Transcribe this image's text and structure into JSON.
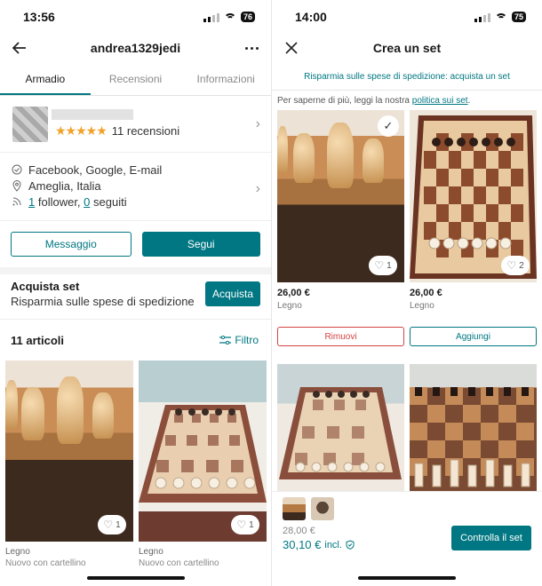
{
  "left": {
    "status": {
      "time": "13:56",
      "battery": "76"
    },
    "header": {
      "title": "andrea1329jedi"
    },
    "tabs": [
      {
        "label": "Armadio",
        "active": true
      },
      {
        "label": "Recensioni",
        "active": false
      },
      {
        "label": "Informazioni",
        "active": false
      }
    ],
    "profile": {
      "stars": "★★★★★",
      "reviews": "11 recensioni"
    },
    "details": {
      "verified": "Facebook, Google, E-mail",
      "location": "Ameglia, Italia",
      "followers_num": "1",
      "followers_label": " follower, ",
      "following_num": "0",
      "following_label": " seguiti"
    },
    "buttons": {
      "message": "Messaggio",
      "follow": "Segui"
    },
    "bundle": {
      "title": "Acquista set",
      "subtitle": "Risparmia sulle spese di spedizione",
      "button": "Acquista"
    },
    "articles": {
      "count": "11 articoli",
      "filter": "Filtro"
    },
    "items": [
      {
        "likes": "1",
        "brand": "Legno",
        "condition": "Nuovo con cartellino"
      },
      {
        "likes": "1",
        "brand": "Legno",
        "condition": "Nuovo con cartellino"
      }
    ]
  },
  "right": {
    "status": {
      "time": "14:00",
      "battery": "75"
    },
    "header": {
      "title": "Crea un set"
    },
    "promo": "Risparmia sulle spese di spedizione: acquista un set",
    "info": {
      "text": "Per saperne di più, leggi la nostra ",
      "link": "politica sui set",
      "end": "."
    },
    "items": [
      {
        "likes": "1",
        "price": "26,00 €",
        "brand": "Legno",
        "action": "Rimuovi",
        "selected": true
      },
      {
        "likes": "2",
        "price": "26,00 €",
        "brand": "Legno",
        "action": "Aggiungi",
        "selected": false
      }
    ],
    "footer": {
      "old_price": "28,00 €",
      "new_price": "30,10 €",
      "incl": "incl.",
      "button": "Controlla il set"
    }
  },
  "colors": {
    "accent": "#007782",
    "remove": "#d34444",
    "stars": "#f1a22a"
  }
}
